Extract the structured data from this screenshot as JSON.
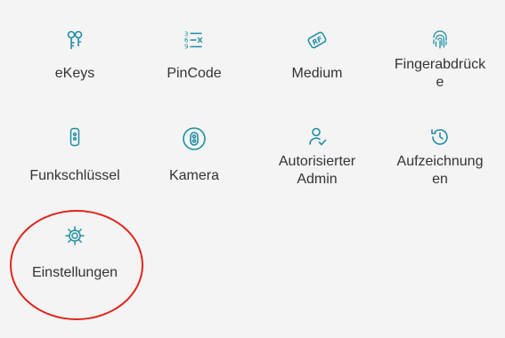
{
  "menu": {
    "items": [
      {
        "label": "eKeys",
        "icon": "ekeys-icon"
      },
      {
        "label": "PinCode",
        "icon": "pincode-icon"
      },
      {
        "label": "Medium",
        "icon": "rf-card-icon"
      },
      {
        "label": "Fingerabdrück\ne",
        "icon": "fingerprint-icon"
      },
      {
        "label": "Funkschlüssel",
        "icon": "remote-key-icon"
      },
      {
        "label": "Kamera",
        "icon": "camera-icon"
      },
      {
        "label": "Autorisierter\nAdmin",
        "icon": "authorized-admin-icon"
      },
      {
        "label": "Aufzeichnung\nen",
        "icon": "history-icon"
      },
      {
        "label": "Einstellungen",
        "icon": "settings-gear-icon"
      }
    ]
  },
  "colors": {
    "accent": "#1f8ea5",
    "highlight_circle": "#e0251b",
    "text": "#333333",
    "background": "#f4f4f4"
  }
}
